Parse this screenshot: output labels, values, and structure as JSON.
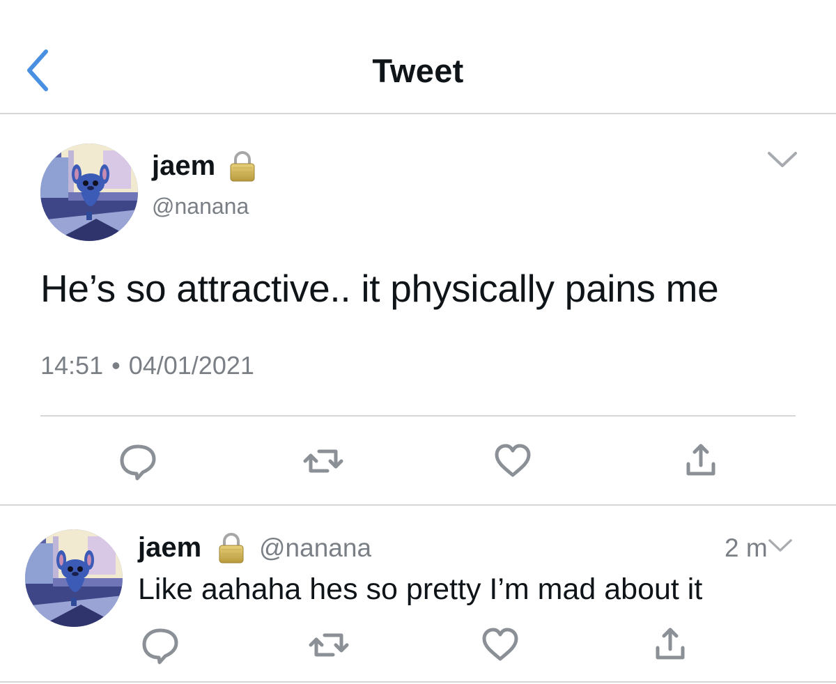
{
  "header": {
    "title": "Tweet",
    "back_icon": "chevron-left-icon",
    "accent_color": "#4a90e2"
  },
  "main_tweet": {
    "author": {
      "display_name": "jaem",
      "handle": "@nanana",
      "protected": true
    },
    "text": "He’s so attractive.. it physically pains me",
    "time": "14:51",
    "separator": "•",
    "date": "04/01/2021",
    "actions": [
      "reply-icon",
      "retweet-icon",
      "like-icon",
      "share-icon"
    ]
  },
  "reply": {
    "author": {
      "display_name": "jaem",
      "handle": "@nanana",
      "protected": true
    },
    "relative_time": "2 m",
    "text": "Like aahaha hes so pretty I’m mad about it",
    "actions": [
      "reply-icon",
      "retweet-icon",
      "like-icon",
      "share-icon"
    ]
  },
  "colors": {
    "text": "#0f1419",
    "secondary": "#7a7f85",
    "divider": "#d6d6d8",
    "icon": "#8b9096"
  }
}
